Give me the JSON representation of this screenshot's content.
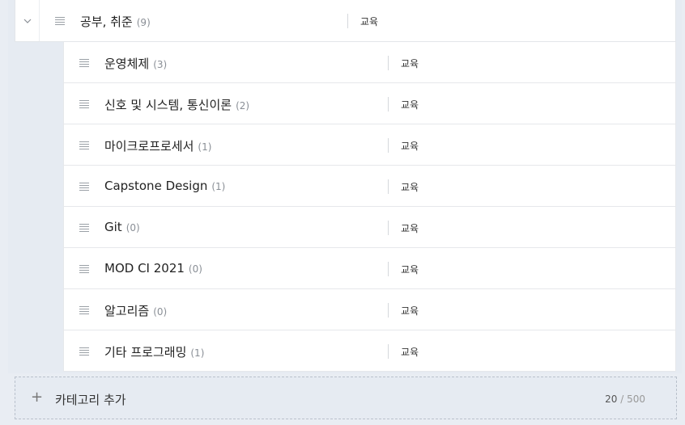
{
  "parent": {
    "name": "공부, 취준",
    "count": "(9)",
    "tag": "교육"
  },
  "children": [
    {
      "name": "운영체제",
      "count": "(3)",
      "tag": "교육"
    },
    {
      "name": "신호 및 시스템, 통신이론",
      "count": "(2)",
      "tag": "교육"
    },
    {
      "name": "마이크로프로세서",
      "count": "(1)",
      "tag": "교육"
    },
    {
      "name": "Capstone Design",
      "count": "(1)",
      "tag": "교육"
    },
    {
      "name": "Git",
      "count": "(0)",
      "tag": "교육"
    },
    {
      "name": "MOD CI 2021",
      "count": "(0)",
      "tag": "교육"
    },
    {
      "name": "알고리즘",
      "count": "(0)",
      "tag": "교육"
    },
    {
      "name": "기타 프로그래밍",
      "count": "(1)",
      "tag": "교육"
    }
  ],
  "add": {
    "plus": "+",
    "label": "카테고리 추가",
    "current": "20",
    "separator": "/",
    "max": "500"
  }
}
